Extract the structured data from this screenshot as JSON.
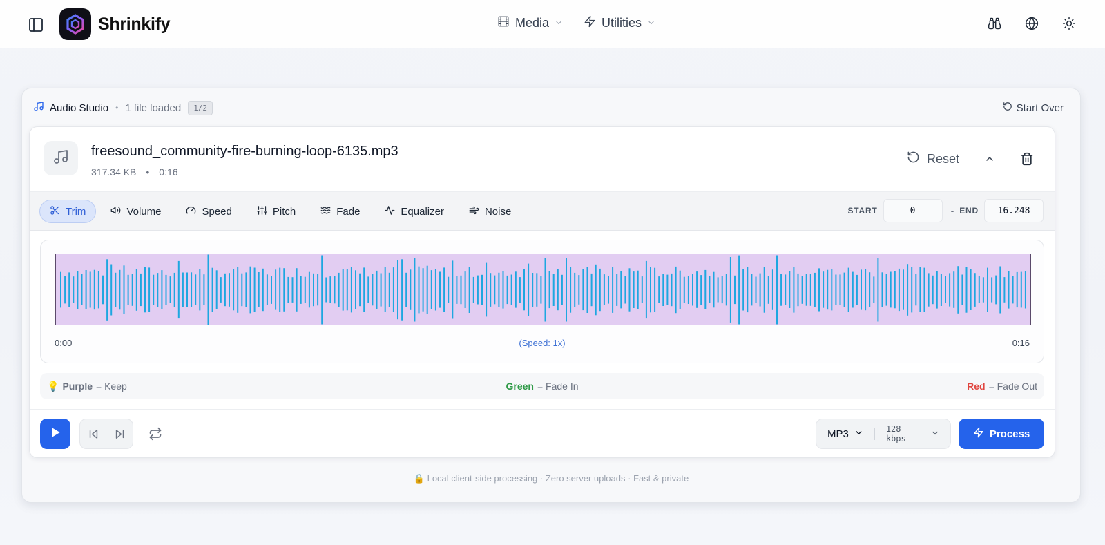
{
  "header": {
    "brand": "Shrinkify",
    "nav": [
      {
        "label": "Media",
        "icon": "film-icon"
      },
      {
        "label": "Utilities",
        "icon": "bolt-icon"
      }
    ],
    "right_icons": [
      "binoculars-icon",
      "globe-icon",
      "sun-icon"
    ]
  },
  "studio": {
    "title": "Audio Studio",
    "files_loaded": "1 file loaded",
    "count": "1/2",
    "start_over": "Start Over"
  },
  "file": {
    "name": "freesound_community-fire-burning-loop-6135.mp3",
    "size": "317.34 KB",
    "separator": "•",
    "duration": "0:16",
    "reset_label": "Reset"
  },
  "tabs": [
    {
      "label": "Trim",
      "icon": "scissors-icon",
      "active": true
    },
    {
      "label": "Volume",
      "icon": "volume-icon",
      "active": false
    },
    {
      "label": "Speed",
      "icon": "gauge-icon",
      "active": false
    },
    {
      "label": "Pitch",
      "icon": "sliders-icon",
      "active": false
    },
    {
      "label": "Fade",
      "icon": "waves-icon",
      "active": false
    },
    {
      "label": "Equalizer",
      "icon": "activity-icon",
      "active": false
    },
    {
      "label": "Noise",
      "icon": "wind-icon",
      "active": false
    }
  ],
  "range": {
    "start_label": "START",
    "start_value": "0",
    "dash": "-",
    "end_label": "END",
    "end_value": "16.248"
  },
  "waveform": {
    "time_start": "0:00",
    "time_end": "0:16",
    "speed_label": "(Speed: 1x)",
    "bar_color": "#1ea7e0",
    "keep_region_color": "#e2cdf2"
  },
  "legend": {
    "icon": "💡",
    "keep_color_word": "Purple",
    "keep_text": "= Keep",
    "fade_in_color_word": "Green",
    "fade_in_text": "= Fade In",
    "fade_out_color_word": "Red",
    "fade_out_text": "= Fade Out"
  },
  "controls": {
    "format": "MP3",
    "bitrate": "128 kbps",
    "process_label": "Process"
  },
  "footer": {
    "note": "🔒 Local client-side processing · Zero server uploads · Fast & private"
  },
  "colors": {
    "accent": "#2563eb",
    "active_tab_bg": "#dbe5fb"
  }
}
